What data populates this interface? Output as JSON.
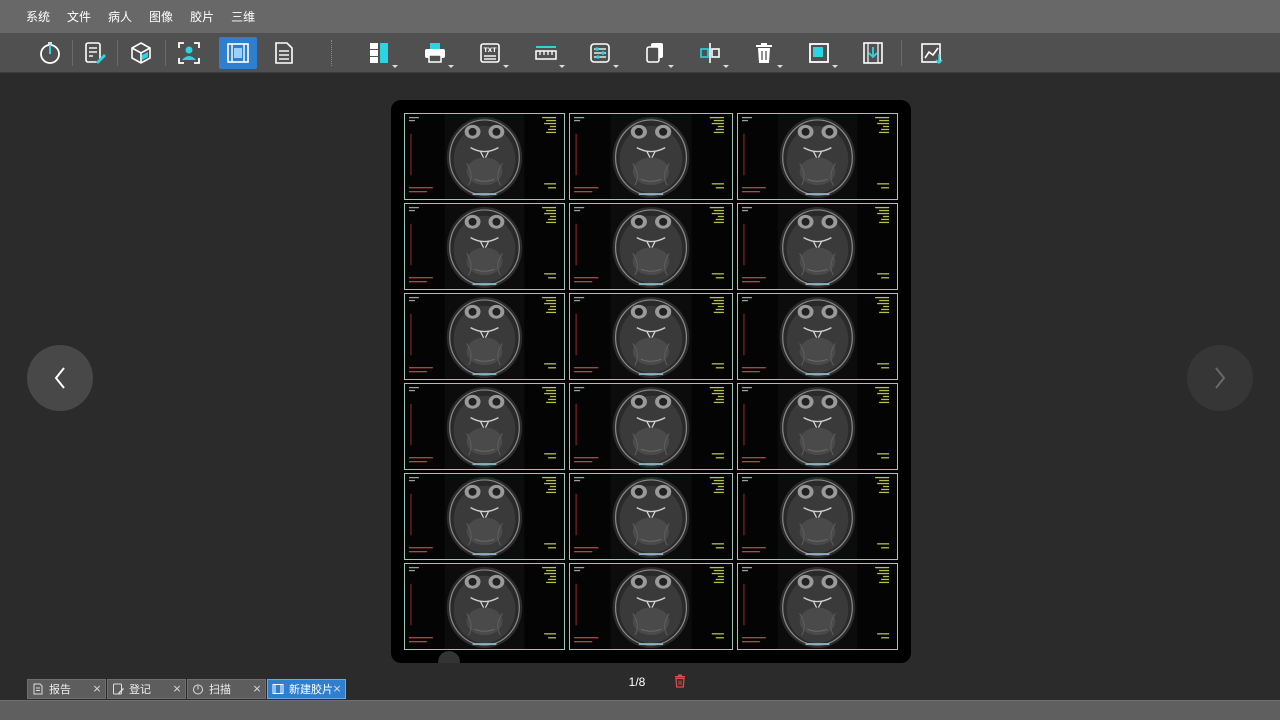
{
  "menubar": {
    "items": [
      {
        "label": "系统"
      },
      {
        "label": "文件"
      },
      {
        "label": "病人"
      },
      {
        "label": "图像"
      },
      {
        "label": "胶片"
      },
      {
        "label": "三维"
      }
    ]
  },
  "toolbar": {
    "buttons": [
      {
        "icon": "timer-icon",
        "active": false
      },
      {
        "icon": "report-edit-icon",
        "active": false
      },
      {
        "icon": "cube-3d-icon",
        "active": false
      },
      {
        "icon": "patient-scan-icon",
        "active": false
      },
      {
        "icon": "film-icon",
        "active": true
      },
      {
        "icon": "document-icon",
        "active": false
      },
      {
        "icon": "layout-icon",
        "active": false
      },
      {
        "icon": "printer-icon",
        "active": false
      },
      {
        "icon": "text-overlay-icon",
        "active": false
      },
      {
        "icon": "ruler-icon",
        "active": false
      },
      {
        "icon": "adjust-sliders-icon",
        "active": false
      },
      {
        "icon": "copy-icon",
        "active": false
      },
      {
        "icon": "align-icon",
        "active": false
      },
      {
        "icon": "trash-icon",
        "active": false
      },
      {
        "icon": "frame-icon",
        "active": false
      },
      {
        "icon": "film-export-icon",
        "active": false
      },
      {
        "icon": "chart-export-icon",
        "active": false
      }
    ],
    "accent_color": "#2f7fd0",
    "icon_highlight_color": "#2ad4e0"
  },
  "film": {
    "rows": 6,
    "columns": 3,
    "current_page": "1/8"
  },
  "tabs": [
    {
      "label": "报告",
      "icon": "report-icon",
      "active": false
    },
    {
      "label": "登记",
      "icon": "register-icon",
      "active": false
    },
    {
      "label": "扫描",
      "icon": "scan-icon",
      "active": false
    },
    {
      "label": "新建胶片",
      "icon": "film-icon",
      "active": true
    }
  ],
  "tab_close_glyph": "×"
}
